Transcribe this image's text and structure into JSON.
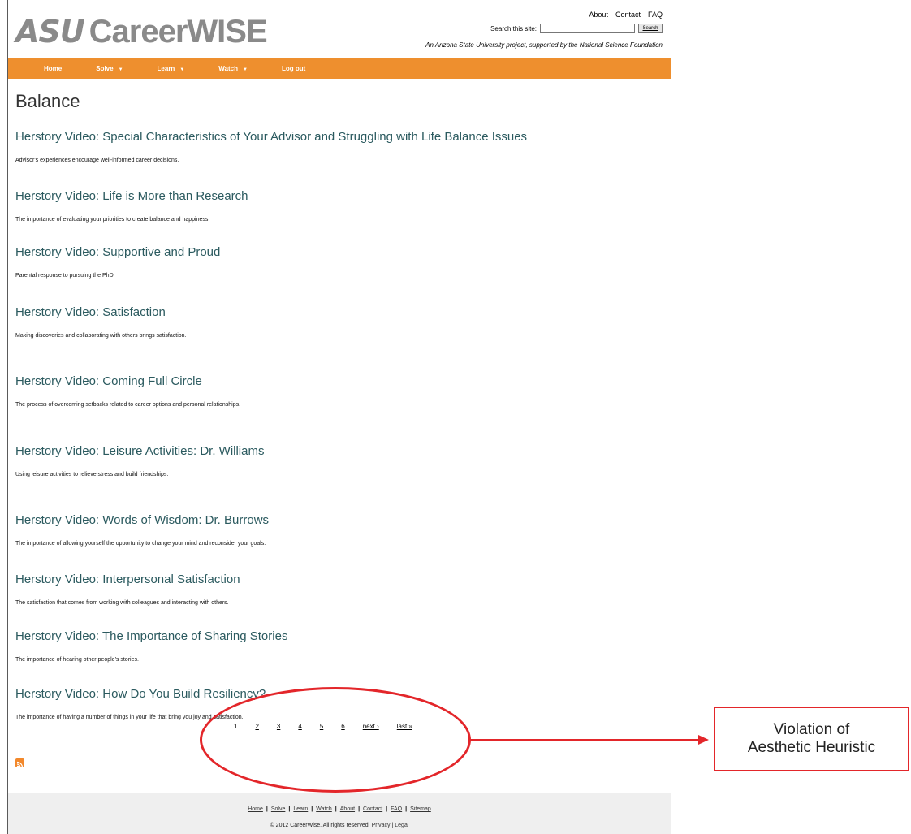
{
  "header": {
    "logo_asu": "ASU",
    "logo_name": "CareerWISE",
    "top_links": [
      "About",
      "Contact",
      "FAQ"
    ],
    "search_label": "Search this site:",
    "search_button": "Search",
    "tagline": "An Arizona State University project, supported by the National Science Foundation"
  },
  "nav": {
    "items": [
      {
        "label": "Home",
        "has_dropdown": false
      },
      {
        "label": "Solve",
        "has_dropdown": true
      },
      {
        "label": "Learn",
        "has_dropdown": true
      },
      {
        "label": "Watch",
        "has_dropdown": true
      },
      {
        "label": "Log out",
        "has_dropdown": false
      }
    ],
    "dropdown_glyph": "▼"
  },
  "page": {
    "title": "Balance",
    "entries": [
      {
        "title": "Herstory Video: Special Characteristics of Your Advisor and Struggling with Life Balance Issues",
        "desc": "Advisor's experiences encourage well-informed career decisions."
      },
      {
        "title": "Herstory Video: Life is More than Research",
        "desc": "The importance of evaluating your priorities to create balance and happiness."
      },
      {
        "title": "Herstory Video: Supportive and Proud",
        "desc": "Parental response to pursuing the PhD."
      },
      {
        "title": "Herstory Video: Satisfaction",
        "desc": "Making discoveries and collaborating with others brings satisfaction."
      },
      {
        "title": "Herstory Video: Coming Full Circle",
        "desc": "The process of overcoming setbacks related to career options and personal relationships."
      },
      {
        "title": "Herstory Video: Leisure Activities: Dr. Williams",
        "desc": "Using leisure activities to relieve stress and build friendships."
      },
      {
        "title": "Herstory Video: Words of Wisdom: Dr. Burrows",
        "desc": "The importance of allowing yourself the opportunity to change your mind and reconsider your goals."
      },
      {
        "title": "Herstory Video: Interpersonal Satisfaction",
        "desc": "The satisfaction that comes from working with colleagues and interacting with others."
      },
      {
        "title": "Herstory Video: The Importance of Sharing Stories",
        "desc": "The importance of hearing other people's stories."
      },
      {
        "title": "Herstory Video: How Do You Build Resiliency?",
        "desc": "The importance of having a number of things in your life that bring you joy and satisfaction."
      }
    ]
  },
  "pager": {
    "current": "1",
    "pages": [
      "2",
      "3",
      "4",
      "5",
      "6"
    ],
    "next": "next ›",
    "last": "last »"
  },
  "footer": {
    "links": [
      "Home",
      "Solve",
      "Learn",
      "Watch",
      "About",
      "Contact",
      "FAQ",
      "Sitemap"
    ],
    "separator": "|",
    "copyright": "© 2012 CareerWise. All rights reserved.",
    "privacy": "Privacy",
    "legal": "Legal"
  },
  "annotation": {
    "line1": "Violation of",
    "line2": "Aesthetic Heuristic",
    "color": "#e3262a"
  },
  "colors": {
    "nav_orange": "#ee8f2e",
    "title_teal": "#2b5a5f",
    "footer_gray": "#efefef"
  }
}
